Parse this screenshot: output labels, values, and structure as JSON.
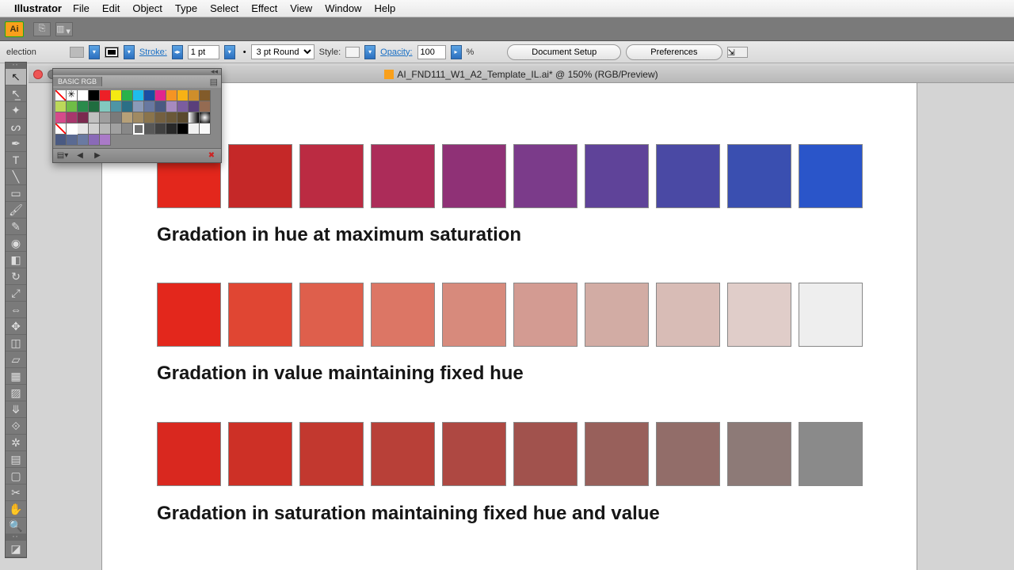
{
  "menubar": {
    "app": "Illustrator",
    "items": [
      "File",
      "Edit",
      "Object",
      "Type",
      "Select",
      "Effect",
      "View",
      "Window",
      "Help"
    ]
  },
  "control": {
    "selection_label": "election",
    "stroke_label": "Stroke:",
    "stroke_weight": "1 pt",
    "brush": "3 pt Round",
    "style_label": "Style:",
    "opacity_label": "Opacity:",
    "opacity_value": "100",
    "opacity_unit": "%",
    "doc_setup": "Document Setup",
    "preferences": "Preferences"
  },
  "document": {
    "title": "AI_FND111_W1_A2_Template_IL.ai* @ 150% (RGB/Preview)"
  },
  "panel": {
    "title": "BASIC RGB"
  },
  "rows": {
    "hue": {
      "colors": [
        "#e3271c",
        "#c52828",
        "#bb2b42",
        "#ac2c59",
        "#8f3176",
        "#7b3b8a",
        "#5f4399",
        "#4a49a4",
        "#3a4fb0",
        "#2a55c9"
      ],
      "caption": "Gradation in hue at maximum saturation"
    },
    "value": {
      "colors": [
        "#e3271c",
        "#e04633",
        "#de5f4c",
        "#dc7665",
        "#d78a7c",
        "#d39b92",
        "#d2aca4",
        "#d8bcb6",
        "#e0cdc9",
        "#eeeeee"
      ],
      "caption": "Gradation in value maintaining fixed hue"
    },
    "sat": {
      "colors": [
        "#d9281f",
        "#cd3026",
        "#c2382f",
        "#b84038",
        "#ae4842",
        "#a1524d",
        "#98605b",
        "#926d69",
        "#8d7a77",
        "#8a8a8a"
      ],
      "caption": "Gradation in saturation maintaining fixed hue and value"
    }
  },
  "swatch_rows": [
    [
      "none",
      "reg",
      "#ffffff",
      "#000000",
      "#ec2027",
      "#f4ea13",
      "#2ab24a",
      "#1fbcea",
      "#1b4ea3",
      "#e2258d",
      "#f59423",
      "#f7b215",
      "#cf8e2b",
      "#825b2a"
    ],
    [
      "#bcd85a",
      "#6fbd46",
      "#2a8b4b",
      "#1f6d3f",
      "#82c9bf",
      "#4e95a5",
      "#2b6f86",
      "#8a9ab8",
      "#6878a0",
      "#4a5a82",
      "#a68abf",
      "#7b5d9f",
      "#5a3f7b",
      "#946b52"
    ],
    [
      "#d64b8a",
      "#a8376c",
      "#7b2a4f",
      "#c0c0c0",
      "#9e9e9e",
      "#7a7a7a",
      "#b6a078",
      "#a08a62",
      "#8a744c",
      "#746040",
      "#6a5838",
      "#5a4a2e",
      "grad",
      "radial"
    ],
    [
      "none",
      "#ffffff",
      "#e8e8e8",
      "#d0d0d0",
      "#b8b8b8",
      "#a0a0a0",
      "#888888",
      "#707070",
      "#585858",
      "#404040",
      "#282828",
      "#000000",
      "#f0f0f0",
      "#f8f8f8"
    ],
    [
      "#4a5a82",
      "#5a6a92",
      "#6a7aa2",
      "#8a6ab8",
      "#aa7ac8"
    ]
  ]
}
